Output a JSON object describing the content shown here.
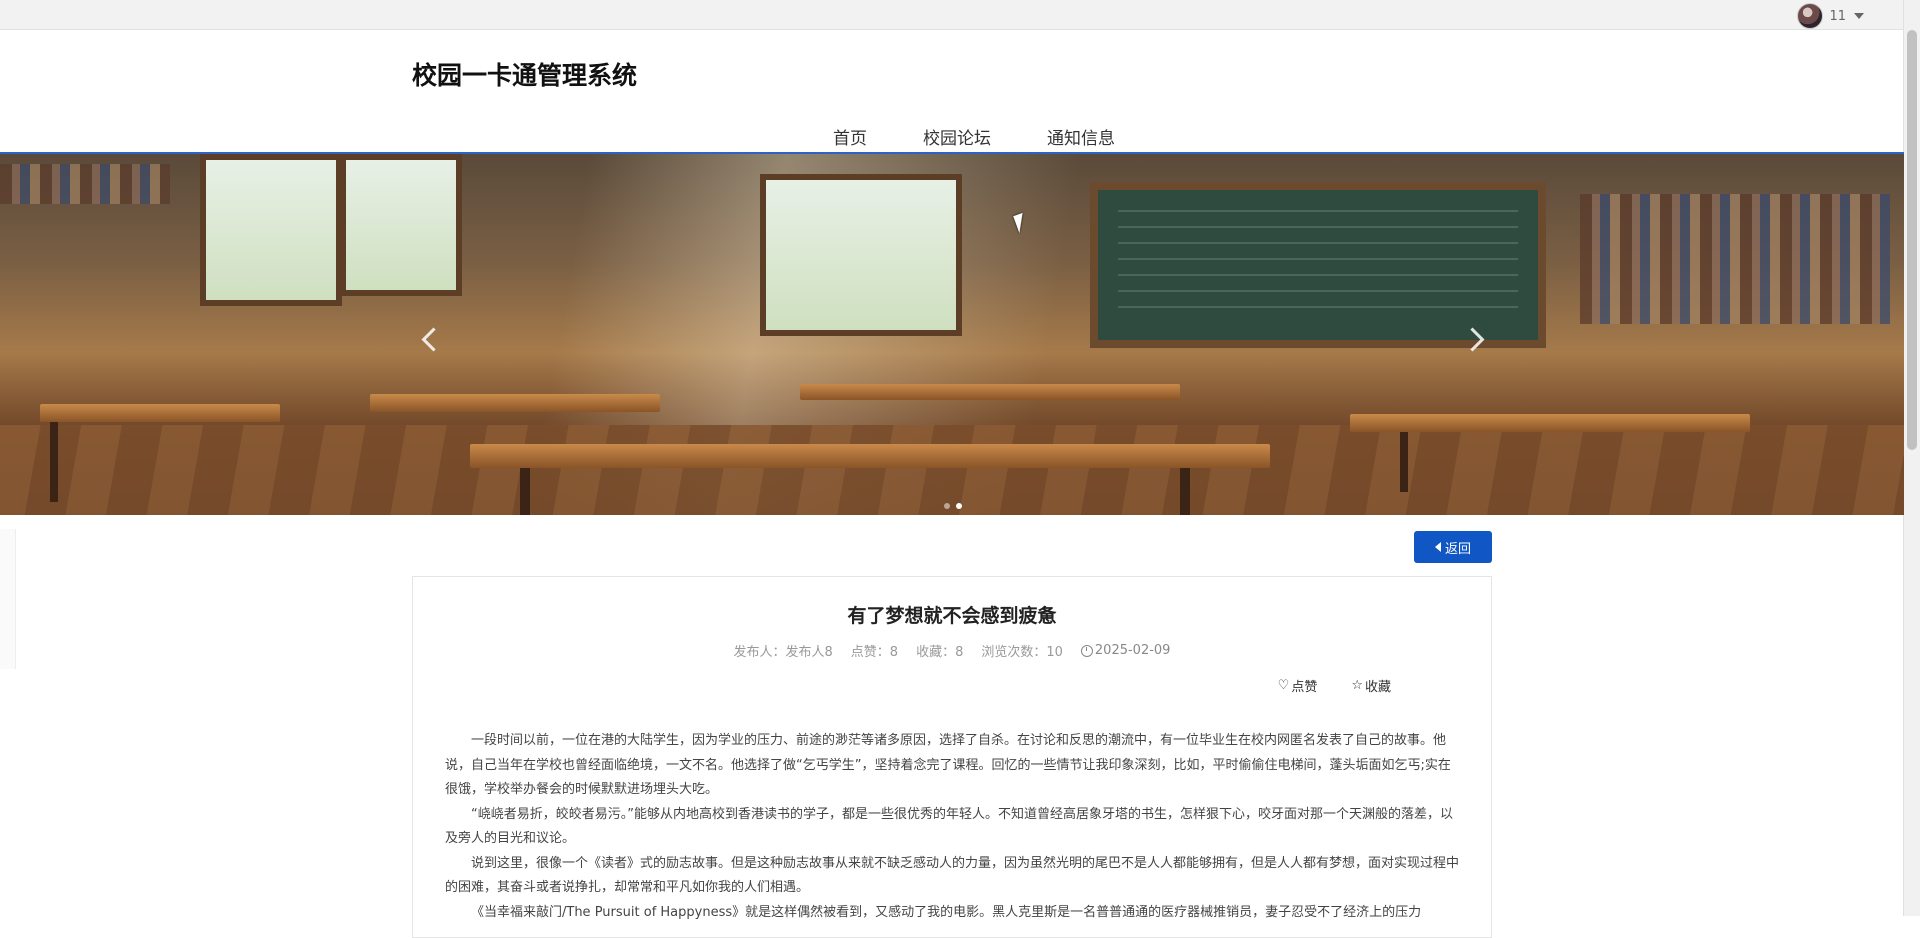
{
  "topbar": {
    "user_count": "11"
  },
  "site": {
    "title": "校园一卡通管理系统"
  },
  "nav": [
    {
      "label": "首页"
    },
    {
      "label": "校园论坛"
    },
    {
      "label": "通知信息"
    }
  ],
  "back_button": {
    "label": "返回"
  },
  "article": {
    "title": "有了梦想就不会感到疲惫",
    "meta": {
      "author": "发布人：发布人8",
      "likes": "点赞：8",
      "favorites": "收藏：8",
      "views": "浏览次数：10",
      "date": "2025-02-09"
    },
    "actions": {
      "like": "点赞",
      "favorite": "收藏"
    },
    "paragraphs": [
      "一段时间以前，一位在港的大陆学生，因为学业的压力、前途的渺茫等诸多原因，选择了自杀。在讨论和反思的潮流中，有一位毕业生在校内网匿名发表了自己的故事。他说，自己当年在学校也曾经面临绝境，一文不名。他选择了做“乞丐学生”，坚持着念完了课程。回忆的一些情节让我印象深刻，比如，平时偷偷住电梯间，蓬头垢面如乞丐;实在很饿，学校举办餐会的时候默默进场埋头大吃。",
      "“峣峣者易折，皎皎者易污。”能够从内地高校到香港读书的学子，都是一些很优秀的年轻人。不知道曾经高居象牙塔的书生，怎样狠下心，咬牙面对那一个天渊般的落差，以及旁人的目光和议论。",
      "说到这里，很像一个《读者》式的励志故事。但是这种励志故事从来就不缺乏感动人的力量，因为虽然光明的尾巴不是人人都能够拥有，但是人人都有梦想，面对实现过程中的困难，其奋斗或者说挣扎，却常常和平凡如你我的人们相遇。",
      "《当幸福来敲门/The Pursuit of Happyness》就是这样偶然被看到，又感动了我的电影。黑人克里斯是一名普普通通的医疗器械推销员，妻子忍受不了经济上的压力"
    ]
  },
  "colors": {
    "accent": "#1056c4",
    "banner_border": "#2b64c6"
  }
}
